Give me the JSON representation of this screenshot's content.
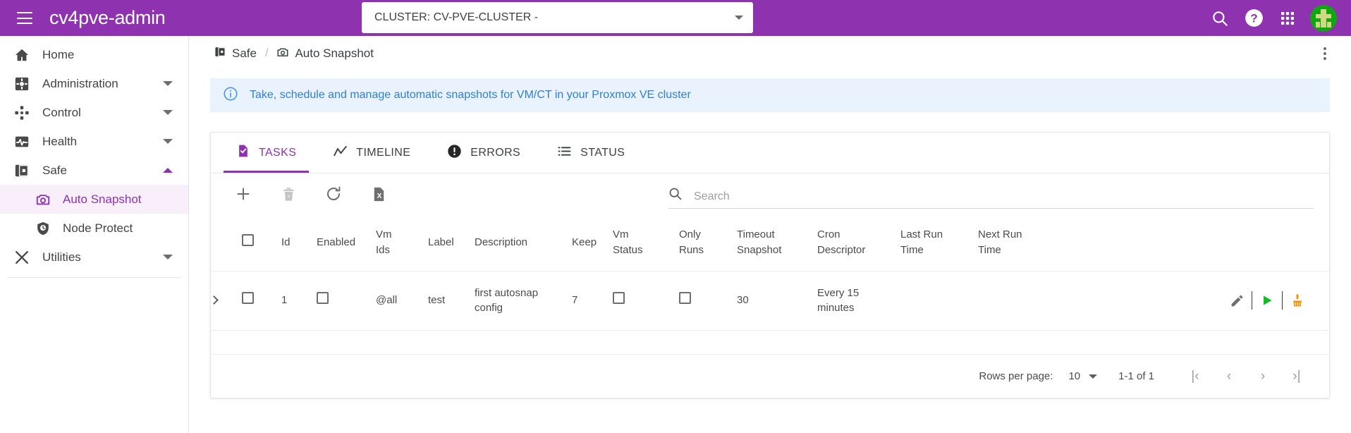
{
  "app": {
    "brand": "cv4pve-admin",
    "cluster_selector": {
      "value": "CLUSTER: CV-PVE-CLUSTER -",
      "caret_icon": "chevron-down-icon"
    },
    "actions": [
      {
        "name": "search-icon",
        "label": "Search"
      },
      {
        "name": "help-icon",
        "label": "Help"
      },
      {
        "name": "apps-grid-icon",
        "label": "Apps"
      },
      {
        "name": "avatar",
        "label": "Account"
      }
    ],
    "colors": {
      "brand_purple": "#8e32b0",
      "info_blue": "#2e7fd4",
      "info_bg": "#eaf3fd",
      "avatar_green": "#11a611",
      "play_green": "#1fbf2f",
      "broom_orange": "#f29100"
    }
  },
  "sidebar": {
    "items": [
      {
        "label": "Home",
        "icon": "home-icon",
        "expandable": false,
        "active": false,
        "sub": false
      },
      {
        "label": "Administration",
        "icon": "gear-box-icon",
        "expandable": true,
        "active": false,
        "sub": false
      },
      {
        "label": "Control",
        "icon": "control-pad-icon",
        "expandable": true,
        "active": false,
        "sub": false
      },
      {
        "label": "Health",
        "icon": "pulse-icon",
        "expandable": true,
        "active": false,
        "sub": false
      },
      {
        "label": "Safe",
        "icon": "safe-icon",
        "expandable": true,
        "active": false,
        "sub": false,
        "expanded": true
      },
      {
        "label": "Auto Snapshot",
        "icon": "camera-icon",
        "expandable": false,
        "active": true,
        "sub": true
      },
      {
        "label": "Node Protect",
        "icon": "shield-clock-icon",
        "expandable": false,
        "active": false,
        "sub": true
      },
      {
        "label": "Utilities",
        "icon": "tools-icon",
        "expandable": true,
        "active": false,
        "sub": false
      }
    ]
  },
  "main": {
    "breadcrumb": [
      {
        "label": "Safe",
        "icon": "safe-icon"
      },
      {
        "label": "Auto Snapshot",
        "icon": "camera-icon"
      }
    ],
    "breadcrumb_separator": "/",
    "kebab_menu": "more-vertical-icon",
    "info_banner": {
      "icon": "info-circle-icon",
      "message": "Take, schedule and manage automatic snapshots for VM/CT in your Proxmox VE cluster"
    },
    "tabs": [
      {
        "label": "TASKS",
        "icon": "task-file-icon",
        "active": true
      },
      {
        "label": "TIMELINE",
        "icon": "timeline-icon",
        "active": false
      },
      {
        "label": "ERRORS",
        "icon": "error-icon",
        "active": false
      },
      {
        "label": "STATUS",
        "icon": "list-icon",
        "active": false
      }
    ],
    "toolbar": [
      {
        "name": "add-button",
        "icon": "plus-icon",
        "disabled": false
      },
      {
        "name": "delete-button",
        "icon": "trash-icon",
        "disabled": true
      },
      {
        "name": "refresh-button",
        "icon": "refresh-icon",
        "disabled": false
      },
      {
        "name": "export-button",
        "icon": "excel-file-icon",
        "disabled": false
      }
    ],
    "search": {
      "icon": "search-icon",
      "value": "",
      "placeholder": "Search"
    },
    "table": {
      "columns": [
        {
          "key": "expand",
          "label": ""
        },
        {
          "key": "select",
          "label": ""
        },
        {
          "key": "id",
          "label": "Id"
        },
        {
          "key": "enabled",
          "label": "Enabled"
        },
        {
          "key": "vm_ids",
          "label": "Vm Ids"
        },
        {
          "key": "label",
          "label": "Label"
        },
        {
          "key": "description",
          "label": "Description"
        },
        {
          "key": "keep",
          "label": "Keep"
        },
        {
          "key": "vm_status",
          "label": "Vm Status"
        },
        {
          "key": "only_runs",
          "label": "Only Runs"
        },
        {
          "key": "timeout",
          "label": "Timeout Snapshot"
        },
        {
          "key": "cron",
          "label": "Cron Descriptor"
        },
        {
          "key": "last_run",
          "label": "Last Run Time"
        },
        {
          "key": "next_run",
          "label": "Next Run Time"
        },
        {
          "key": "actions",
          "label": ""
        }
      ],
      "column_labels": {
        "id": "Id",
        "enabled": "Enabled",
        "vm_ids_l1": "Vm",
        "vm_ids_l2": "Ids",
        "label": "Label",
        "description": "Description",
        "keep": "Keep",
        "vm_status_l1": "Vm",
        "vm_status_l2": "Status",
        "only_runs_l1": "Only",
        "only_runs_l2": "Runs",
        "timeout_l1": "Timeout",
        "timeout_l2": "Snapshot",
        "cron_l1": "Cron",
        "cron_l2": "Descriptor",
        "last_run_l1": "Last Run",
        "last_run_l2": "Time",
        "next_run_l1": "Next Run",
        "next_run_l2": "Time"
      },
      "rows": [
        {
          "expanded": false,
          "selected": false,
          "id": "1",
          "enabled": false,
          "vm_ids": "@all",
          "label": "test",
          "description_l1": "first autosnap",
          "description_l2": "config",
          "keep": "7",
          "vm_status": false,
          "only_runs": false,
          "timeout_snapshot": "30",
          "cron_l1": "Every 15",
          "cron_l2": "minutes",
          "last_run_time": "",
          "next_run_time": "",
          "actions": [
            {
              "name": "edit-row-button",
              "icon": "pencil-icon"
            },
            {
              "name": "run-row-button",
              "icon": "play-icon"
            },
            {
              "name": "cleanup-row-button",
              "icon": "broom-icon"
            }
          ]
        }
      ]
    },
    "pagination": {
      "rows_per_page_label": "Rows per page:",
      "rows_per_page_value": "10",
      "range": "1-1 of 1",
      "first_page_icon": "first-page-icon",
      "prev_page_icon": "chevron-left-icon",
      "next_page_icon": "chevron-right-icon",
      "last_page_icon": "last-page-icon",
      "first_page_glyph": "|‹",
      "prev_page_glyph": "‹",
      "next_page_glyph": "›",
      "last_page_glyph": "›|"
    }
  }
}
